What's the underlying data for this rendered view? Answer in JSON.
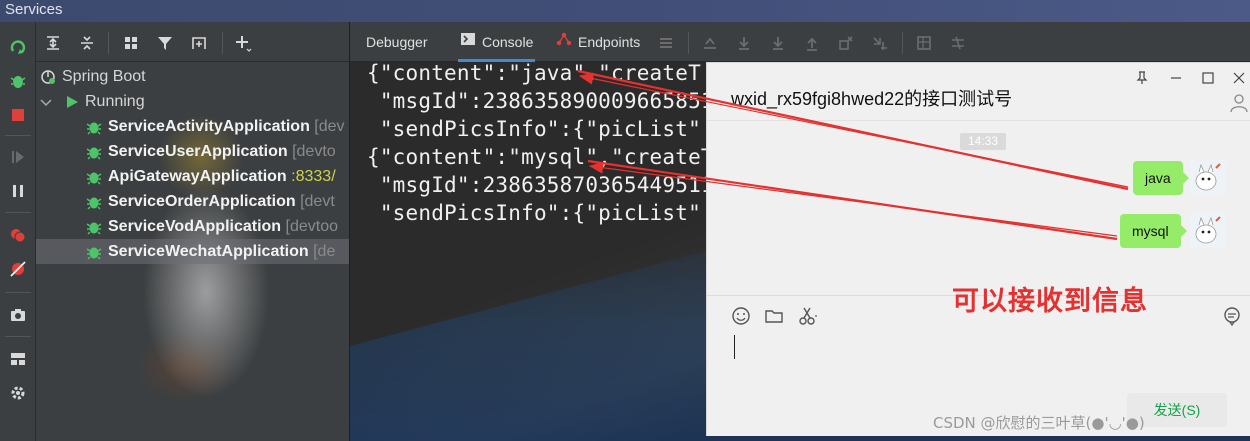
{
  "window": {
    "title": "Services"
  },
  "tree": {
    "items": [
      {
        "label": "Spring Boot",
        "suffix": ""
      },
      {
        "label": "Running",
        "suffix": ""
      },
      {
        "label": "ServiceActivityApplication",
        "suffix": "[dev"
      },
      {
        "label": "ServiceUserApplication",
        "suffix": "[devto"
      },
      {
        "label": "ApiGatewayApplication",
        "suffix": ":8333/"
      },
      {
        "label": "ServiceOrderApplication",
        "suffix": "[devt"
      },
      {
        "label": "ServiceVodApplication",
        "suffix": "[devtoo"
      },
      {
        "label": "ServiceWechatApplication",
        "suffix": "[de"
      }
    ]
  },
  "console": {
    "tabs": [
      {
        "label": "Debugger",
        "icon": "none"
      },
      {
        "label": "Console",
        "icon": "console-icon"
      },
      {
        "label": "Endpoints",
        "icon": "endpoints-icon"
      }
    ],
    "lines": [
      "{\"content\":\"java\",\"createT",
      " \"msgId\":238635890009665851",
      " \"sendPicsInfo\":{\"picList\"",
      "{\"content\":\"mysql\",\"createT",
      " \"msgId\":238635870365449511",
      " \"sendPicsInfo\":{\"picList\""
    ]
  },
  "chat": {
    "title": "wxid_rx59fgi8hwed22的接口测试号",
    "time": "14:33",
    "messages": [
      "java",
      "mysql"
    ],
    "send_label": "发送(S)",
    "bubble_color": "#95ec69"
  },
  "annotation": {
    "text": "可以接收到信息",
    "color": "#e53130"
  },
  "watermark": "CSDN @欣慰的三叶草(●'◡'●)"
}
